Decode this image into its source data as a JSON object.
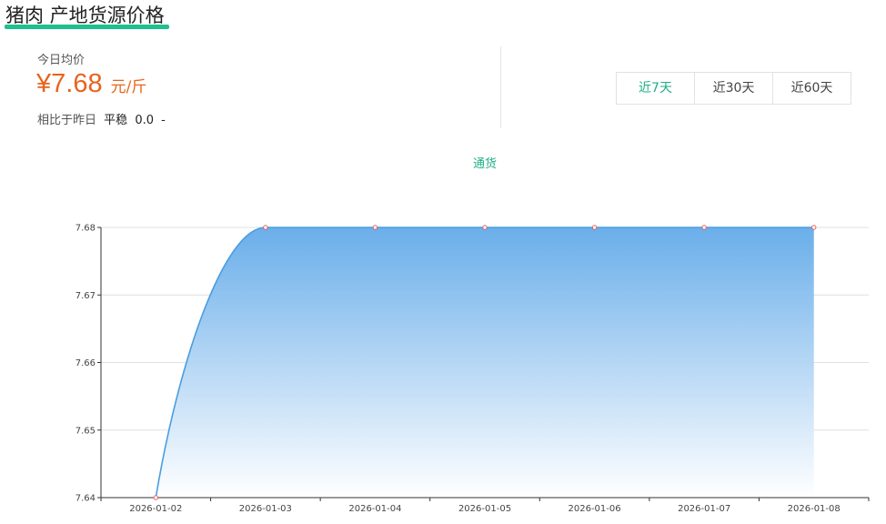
{
  "header": {
    "title": "猪肉 产地货源价格"
  },
  "summary": {
    "today_label": "今日均价",
    "price": "¥7.68",
    "unit": "元/斤",
    "compare_label": "相比于昨日",
    "trend": "平稳",
    "change": "0.0",
    "change_sign": "-"
  },
  "range_tabs": [
    {
      "label": "近7天",
      "active": true
    },
    {
      "label": "近30天",
      "active": false
    },
    {
      "label": "近60天",
      "active": false
    }
  ],
  "colors": {
    "accent": "#1fbf8f",
    "price": "#e8631c",
    "line": "#4a9de0",
    "area_top": "#6aaeea",
    "point": "#e06060"
  },
  "chart_data": {
    "type": "area",
    "x": [
      "2026-01-02",
      "2026-01-03",
      "2026-01-04",
      "2026-01-05",
      "2026-01-06",
      "2026-01-07",
      "2026-01-08"
    ],
    "series": [
      {
        "name": "通货",
        "values": [
          7.64,
          7.68,
          7.68,
          7.68,
          7.68,
          7.68,
          7.68
        ]
      }
    ],
    "yticks": [
      "7.64",
      "7.65",
      "7.66",
      "7.67",
      "7.68"
    ],
    "ylim": [
      7.64,
      7.68
    ],
    "grid": true,
    "legend": "top-center"
  }
}
